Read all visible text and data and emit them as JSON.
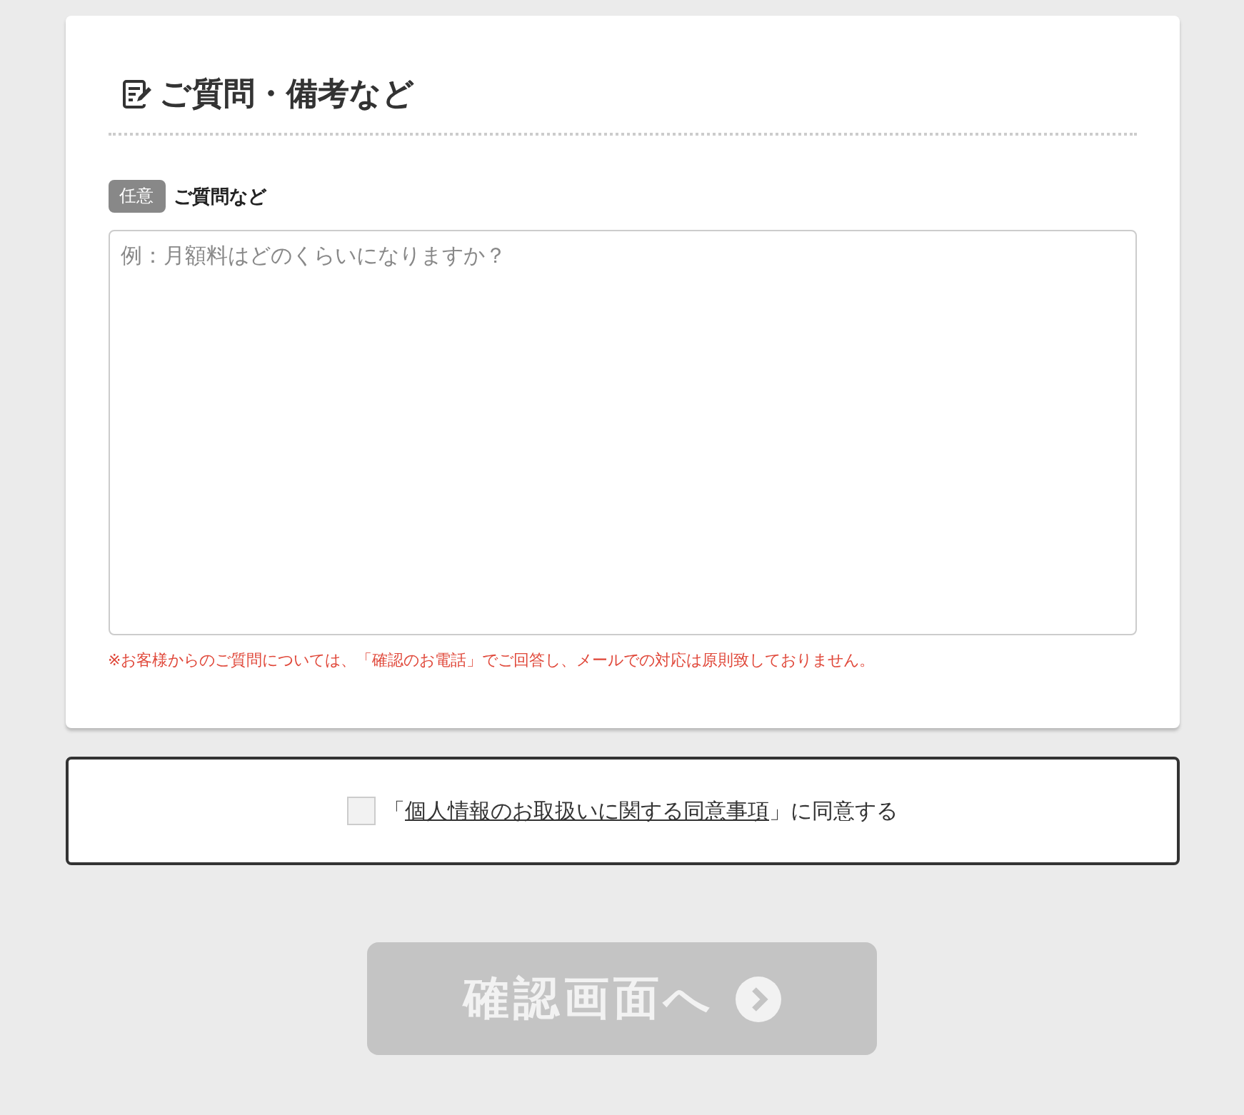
{
  "section": {
    "title": "ご質問・備考など"
  },
  "field": {
    "badge": "任意",
    "label": "ご質問など",
    "placeholder": "例：月額料はどのくらいになりますか？",
    "note": "※お客様からのご質問については、「確認のお電話」でご回答し、メールでの対応は原則致しておりません。"
  },
  "consent": {
    "checked": false,
    "prefix": "「",
    "link": "個人情報のお取扱いに関する同意事項",
    "suffix": "」に同意する"
  },
  "submit": {
    "label": "確認画面へ",
    "disabled": true
  }
}
